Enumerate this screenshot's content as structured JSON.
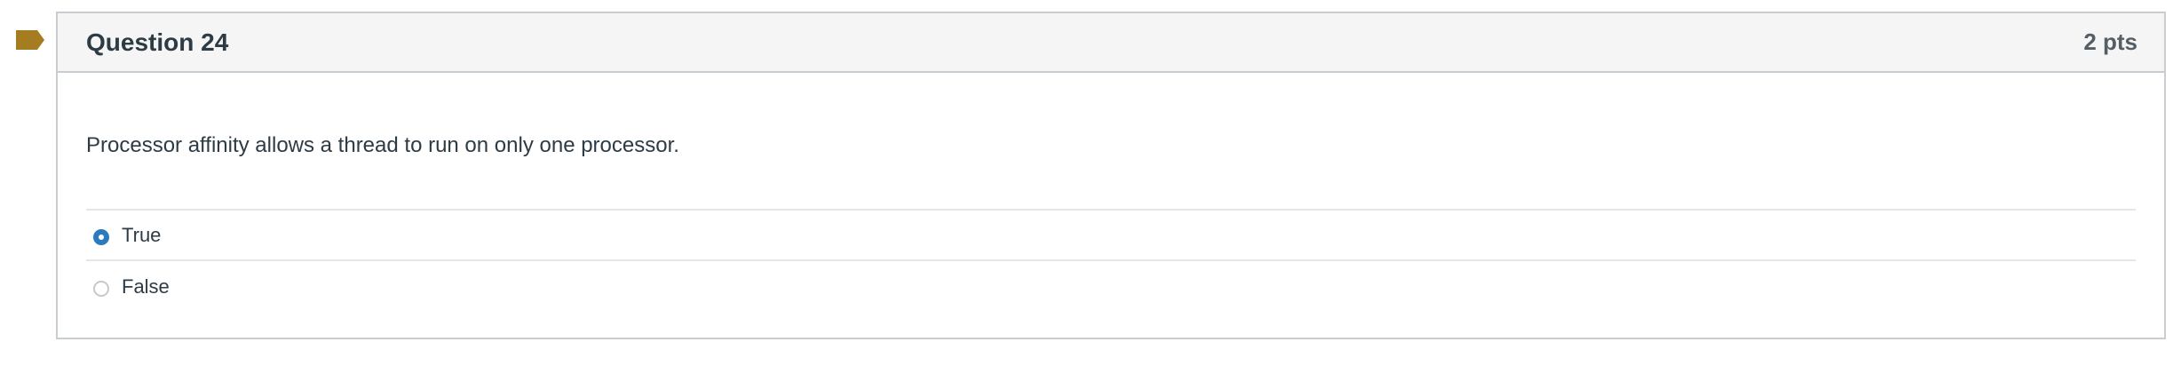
{
  "question": {
    "title": "Question 24",
    "points": "2 pts",
    "text": "Processor affinity allows a thread to run on only one processor.",
    "flag_icon": "bookmark-flag-icon",
    "flag_color": "#a67c20"
  },
  "answers": [
    {
      "label": "True",
      "selected": true
    },
    {
      "label": "False",
      "selected": false
    }
  ],
  "colors": {
    "radio_selected": "#2b7abc",
    "header_background": "#f5f5f5",
    "border": "#c7cdd1"
  }
}
